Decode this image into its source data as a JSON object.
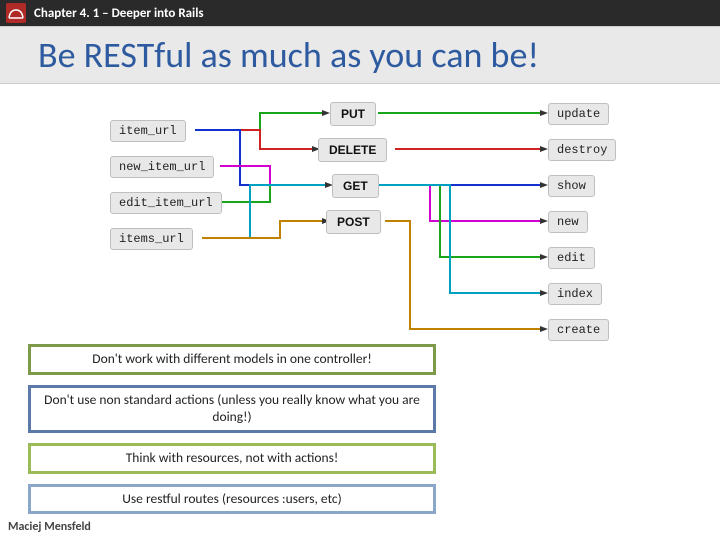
{
  "header": {
    "chapter": "Chapter 4. 1 – Deeper into Rails"
  },
  "title": "Be RESTful as much as you can be!",
  "diagram": {
    "urls": [
      "item_url",
      "new_item_url",
      "edit_item_url",
      "items_url"
    ],
    "verbs": [
      "PUT",
      "DELETE",
      "GET",
      "POST"
    ],
    "actions": [
      "update",
      "destroy",
      "show",
      "new",
      "edit",
      "index",
      "create"
    ],
    "url_to_verb": [
      {
        "from": "item_url",
        "to": "PUT",
        "color": "#1aa51a"
      },
      {
        "from": "item_url",
        "to": "DELETE",
        "color": "#d02222"
      },
      {
        "from": "item_url",
        "to": "GET",
        "color": "#1030d0"
      },
      {
        "from": "new_item_url",
        "to": "GET",
        "color": "#d000d0"
      },
      {
        "from": "edit_item_url",
        "to": "GET",
        "color": "#1aa51a"
      },
      {
        "from": "items_url",
        "to": "GET",
        "color": "#00a0c0"
      },
      {
        "from": "items_url",
        "to": "POST",
        "color": "#c08000"
      }
    ],
    "verb_to_action": [
      {
        "from": "PUT",
        "to": "update",
        "color": "#1aa51a"
      },
      {
        "from": "DELETE",
        "to": "destroy",
        "color": "#d02222"
      },
      {
        "from": "GET",
        "to": "show",
        "color": "#1030d0"
      },
      {
        "from": "GET",
        "to": "new",
        "color": "#d000d0"
      },
      {
        "from": "GET",
        "to": "edit",
        "color": "#1aa51a"
      },
      {
        "from": "GET",
        "to": "index",
        "color": "#00a0c0"
      },
      {
        "from": "POST",
        "to": "create",
        "color": "#c08000"
      }
    ]
  },
  "tips": [
    "Don't work with different models in one controller!",
    "Don't use non standard actions (unless you really know what you are doing!)",
    "Think with resources, not with actions!",
    "Use restful routes (resources :users, etc)"
  ],
  "footer": "Maciej Mensfeld"
}
